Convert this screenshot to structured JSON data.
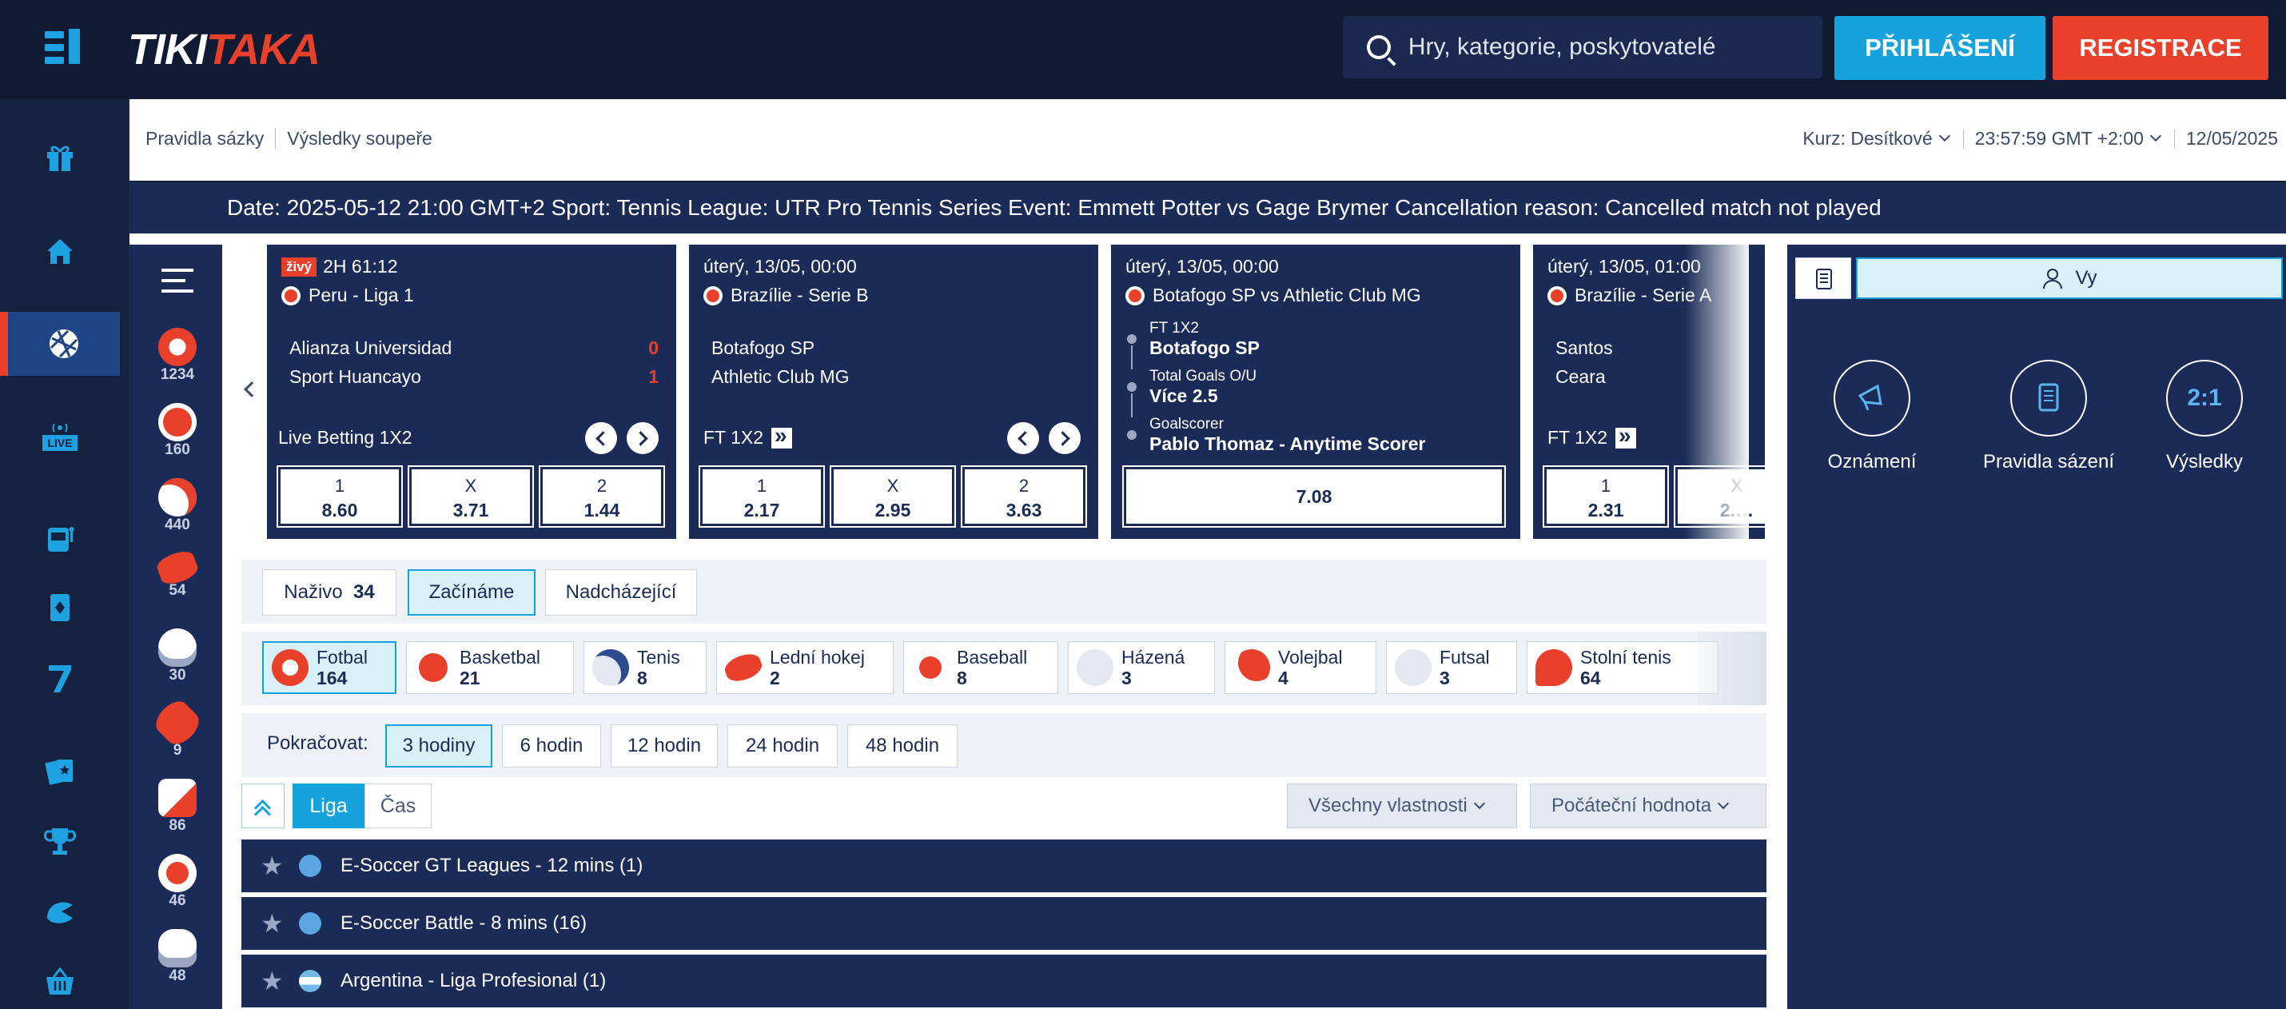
{
  "header": {
    "logo_part1": "TIKI",
    "logo_part2": "TAKA",
    "search_placeholder": "Hry, kategorie, poskytovatelé",
    "login_label": "PŘIHLÁŠENÍ",
    "register_label": "REGISTRACE"
  },
  "subbar": {
    "link_rules": "Pravidla sázky",
    "link_results": "Výsledky soupeře",
    "odds_label": "Kurz:",
    "odds_value": "Desítkové",
    "time": "23:57:59 GMT +2:00",
    "date": "12/05/2025"
  },
  "ticker": "Date: 2025-05-12 21:00 GMT+2 Sport: Tennis League: UTR Pro Tennis Series Event: Emmett Potter vs Gage Brymer Cancellation reason: Cancelled match not played",
  "sport_counts": [
    "1234",
    "160",
    "440",
    "54",
    "30",
    "9",
    "86",
    "46",
    "48"
  ],
  "cards": [
    {
      "live": "živý",
      "time": "2H 61:12",
      "league": "Peru - Liga 1",
      "home": "Alianza Universidad",
      "away": "Sport Huancayo",
      "score_home": "0",
      "score_away": "1",
      "market": "Live Betting 1X2",
      "odds": [
        {
          "l": "1",
          "v": "8.60"
        },
        {
          "l": "X",
          "v": "3.71"
        },
        {
          "l": "2",
          "v": "1.44"
        }
      ]
    },
    {
      "time": "úterý, 13/05, 00:00",
      "league": "Brazílie - Serie B",
      "home": "Botafogo SP",
      "away": "Athletic Club MG",
      "market": "FT 1X2",
      "odds": [
        {
          "l": "1",
          "v": "2.17"
        },
        {
          "l": "X",
          "v": "2.95"
        },
        {
          "l": "2",
          "v": "3.63"
        }
      ]
    },
    {
      "time": "úterý, 13/05, 00:00",
      "league": "Botafogo SP vs Athletic Club MG",
      "bb1_t": "FT 1X2",
      "bb1_v": "Botafogo SP",
      "bb2_t": "Total Goals O/U",
      "bb2_v": "Více 2.5",
      "bb3_t": "Goalscorer",
      "bb3_v": "Pablo Thomaz - Anytime Scorer",
      "price": "7.08"
    },
    {
      "time": "úterý, 13/05, 01:00",
      "league": "Brazílie - Serie A",
      "home": "Santos",
      "away": "Ceara",
      "market": "FT 1X2",
      "odds": [
        {
          "l": "1",
          "v": "2.31"
        },
        {
          "l": "X",
          "v": "2.…"
        }
      ]
    }
  ],
  "tabs": {
    "live": "Naživo",
    "live_count": "34",
    "starting": "Začínáme",
    "upcoming": "Nadcházející"
  },
  "sports": [
    {
      "name": "Fotbal",
      "count": "164",
      "color": "#e8402a"
    },
    {
      "name": "Basketbal",
      "count": "21",
      "color": "#e8402a"
    },
    {
      "name": "Tenis",
      "count": "8",
      "color": "#2e4b8f"
    },
    {
      "name": "Lední hokej",
      "count": "2",
      "color": "#e8402a"
    },
    {
      "name": "Baseball",
      "count": "8",
      "color": "#e8402a"
    },
    {
      "name": "Házená",
      "count": "3",
      "color": "#9aa6c2"
    },
    {
      "name": "Volejbal",
      "count": "4",
      "color": "#e8402a"
    },
    {
      "name": "Futsal",
      "count": "3",
      "color": "#9aa6c2"
    },
    {
      "name": "Stolní tenis",
      "count": "64",
      "color": "#e8402a"
    }
  ],
  "continue": {
    "label": "Pokračovat:",
    "opts": [
      "3 hodiny",
      "6 hodin",
      "12 hodin",
      "24 hodin",
      "48 hodin"
    ]
  },
  "sort": {
    "league": "Liga",
    "time": "Čas",
    "all_props": "Všechny vlastnosti",
    "initial": "Počáteční hodnota"
  },
  "leagues": [
    "E-Soccer GT Leagues - 12 mins (1)",
    "E-Soccer Battle - 8 mins (16)",
    "Argentina - Liga Profesional (1)"
  ],
  "right": {
    "vy": "Vy",
    "ann": "Oznámení",
    "rules": "Pravidla sázení",
    "results": "Výsledky",
    "results_icon": "2:1"
  },
  "colors": {
    "accent": "#16a3dd",
    "brand": "#e8402a",
    "navy": "#1a2b58"
  }
}
